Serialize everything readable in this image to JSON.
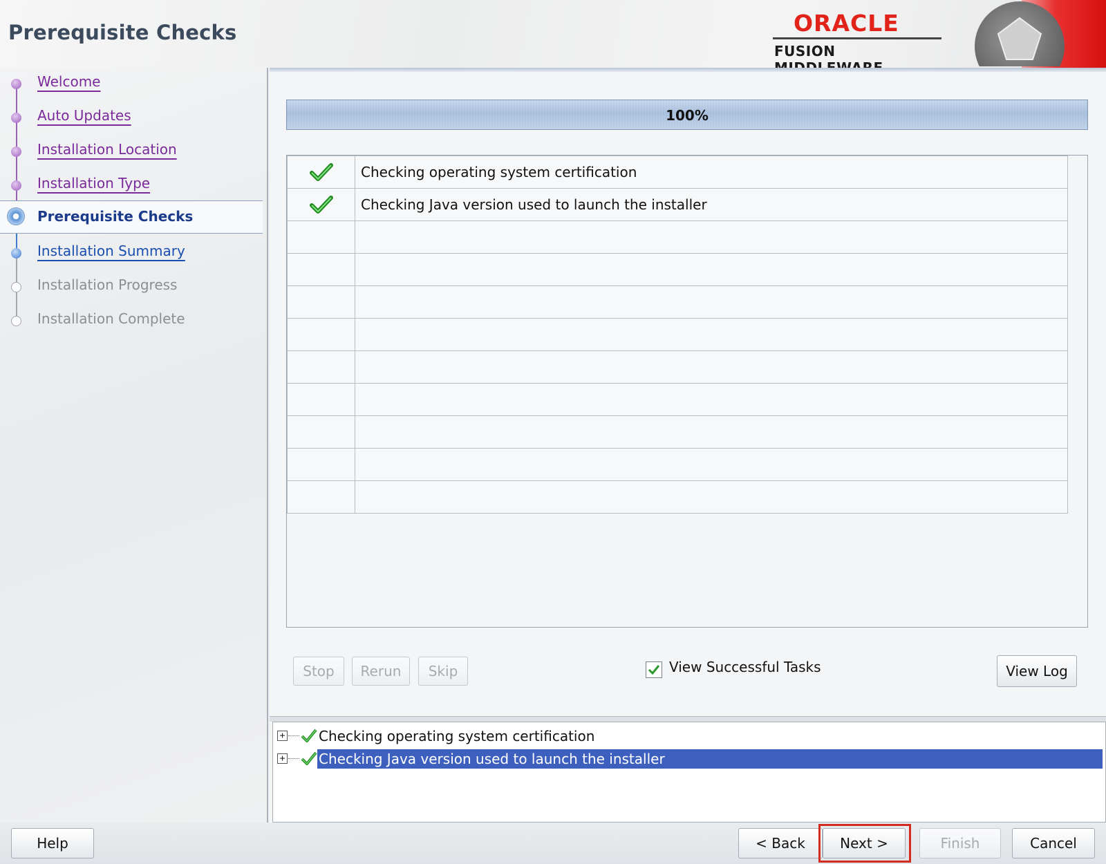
{
  "window": {
    "title": "Prerequisite Checks"
  },
  "brand": {
    "logo_text": "ORACLE",
    "product_text": "FUSION MIDDLEWARE",
    "accent_color": "#e2231a"
  },
  "nav": {
    "items": [
      {
        "label": "Welcome",
        "state": "done"
      },
      {
        "label": "Auto Updates",
        "state": "done"
      },
      {
        "label": "Installation Location",
        "state": "done"
      },
      {
        "label": "Installation Type",
        "state": "done"
      },
      {
        "label": "Prerequisite Checks",
        "state": "current"
      },
      {
        "label": "Installation Summary",
        "state": "next"
      },
      {
        "label": "Installation Progress",
        "state": "todo"
      },
      {
        "label": "Installation Complete",
        "state": "todo"
      }
    ]
  },
  "progress": {
    "value_percent": 100,
    "label": "100%"
  },
  "tasks": {
    "rows": [
      {
        "status": "check-icon",
        "description": "Checking operating system certification"
      },
      {
        "status": "check-icon",
        "description": "Checking Java version used to launch the installer"
      }
    ]
  },
  "task_buttons": {
    "stop_label": "Stop",
    "rerun_label": "Rerun",
    "skip_label": "Skip",
    "view_successful_label": "View Successful Tasks",
    "view_successful_checked": true,
    "view_log_label": "View Log"
  },
  "log_tree": {
    "rows": [
      {
        "label": "Checking operating system certification",
        "selected": false
      },
      {
        "label": "Checking Java version used to launch the installer",
        "selected": true
      }
    ]
  },
  "footer": {
    "help_label": "Help",
    "back_label": "< Back",
    "next_label": "Next >",
    "finish_label": "Finish",
    "cancel_label": "Cancel"
  }
}
